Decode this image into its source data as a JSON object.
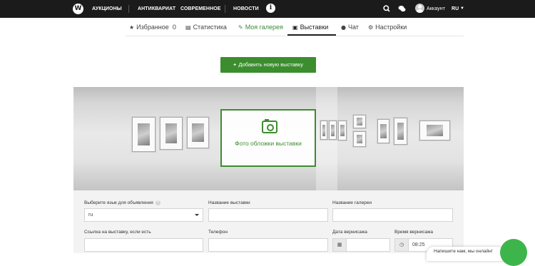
{
  "navbar": {
    "logo": "W",
    "links": [
      "АУКЦИОНЫ",
      "АНТИКВАРИАТ",
      "СОВРЕМЕННОЕ",
      "НОВОСТИ"
    ],
    "info_icon": "i",
    "account_label": "Аккаунт",
    "language": "RU",
    "icons": {
      "search": "search-icon",
      "chat": "chat-bubbles-icon",
      "info": "info-icon"
    }
  },
  "tabs": [
    {
      "icon": "★",
      "label": "Избранное",
      "count": "0"
    },
    {
      "icon": "▤",
      "label": "Статистика"
    },
    {
      "icon": "✎",
      "label": "Моя галерея"
    },
    {
      "icon": "▣",
      "label": "Выставки"
    },
    {
      "icon": "●",
      "label": "Чат"
    },
    {
      "icon": "⚙",
      "label": "Настройки"
    }
  ],
  "add_button": {
    "icon": "+",
    "label": "Добавить новую выставку"
  },
  "cover": {
    "label": "Фото обложки выставки"
  },
  "form": {
    "language_label": "Выберите язык для объявления",
    "language_value": "ru",
    "exhibition_name_label": "Название выставки",
    "gallery_name_label": "Название галереи",
    "link_label": "Ссылка на выставку, если есть",
    "phone_label": "Телефон",
    "opening_date_label": "Дата вернисажа",
    "opening_time_label": "Время вернисажа",
    "opening_time_value": "08:25"
  },
  "chat_widget": {
    "label": "Напишите нам, мы онлайн!"
  },
  "colors": {
    "accent": "#3c8d2e",
    "navbar": "#1b1b1b"
  }
}
